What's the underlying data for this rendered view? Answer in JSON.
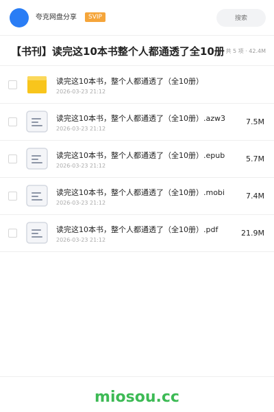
{
  "header": {
    "username": "夸克网盘分享",
    "badge": "SVIP",
    "search_placeholder": "搜索"
  },
  "share": {
    "title": "【书刊】读完这10本书整个人都通透了全10册",
    "meta": "共 5 项 · 42.4M"
  },
  "files": [
    {
      "icon": "folder-icon",
      "name": "读完这10本书，整个人都通透了（全10册）",
      "date": "2026-03-23 21:12",
      "size": ""
    },
    {
      "icon": "document-icon",
      "name": "读完这10本书，整个人都通透了（全10册）.azw3",
      "date": "2026-03-23 21:12",
      "size": "7.5M"
    },
    {
      "icon": "document-icon",
      "name": "读完这10本书，整个人都通透了（全10册）.epub",
      "date": "2026-03-23 21:12",
      "size": "5.7M"
    },
    {
      "icon": "document-icon",
      "name": "读完这10本书，整个人都通透了（全10册）.mobi",
      "date": "2026-03-23 21:12",
      "size": "7.4M"
    },
    {
      "icon": "document-icon",
      "name": "读完这10本书，整个人都通透了（全10册）.pdf",
      "date": "2026-03-23 21:12",
      "size": "21.9M"
    }
  ],
  "footer": {
    "brand": "miosou.cc"
  },
  "colors": {
    "accent": "#2a7df5",
    "badge": "#f5a53a",
    "brand": "#3dba55",
    "folder": "#f8c51c"
  }
}
